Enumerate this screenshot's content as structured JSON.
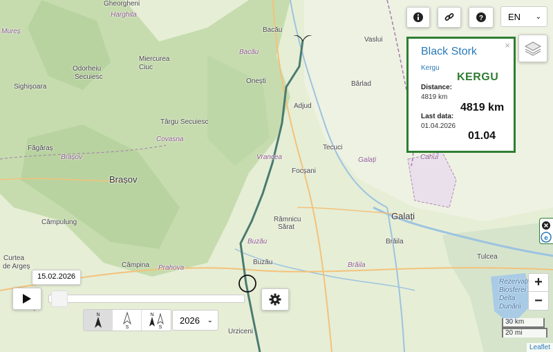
{
  "toolbar": {
    "info_icon": "info-icon",
    "link_icon": "link-icon",
    "help_icon": "help-icon",
    "language": "EN"
  },
  "card": {
    "title": "Black Stork",
    "close": "×",
    "subtitle": "Kergu",
    "name_badge": "KERGU",
    "distance_label": "Distance:",
    "distance_value": "4819 km",
    "distance_big": "4819 km",
    "lastdata_label": "Last data:",
    "lastdata_value": "01.04.2026",
    "lastdata_big": "01.04"
  },
  "timeline": {
    "date": "15.02.2026",
    "year": "2026",
    "compass": [
      "N",
      "S",
      "N",
      "S"
    ]
  },
  "zoom": {
    "in": "+",
    "out": "−"
  },
  "scale": {
    "km": "30 km",
    "mi": "20 mi"
  },
  "attribution": "Leaflet",
  "places": {
    "gheorgheni": "Gheorgheni",
    "harghita": "Harghita",
    "mures": "Mureș",
    "bacau_city": "Bacău",
    "bacau_region": "Bacău",
    "vaslui": "Vaslui",
    "miercurea": "Miercurea",
    "ciuc": "Ciuc",
    "odorheiu": "Odorheiu",
    "secuiesc": "Secuiesc",
    "sighisoara": "Sighișoara",
    "onesti": "Onești",
    "barlad": "Bârlad",
    "adjud": "Adjud",
    "targu": "Târgu Secuiesc",
    "covasna": "Covasna",
    "fagaras": "Făgăraș",
    "brasov_region": "Brașov",
    "brasov_city": "Brașov",
    "tecuci": "Tecuci",
    "galati_region": "Galați",
    "cahul": "Cahul",
    "vrancea": "Vrancea",
    "focsani": "Focșani",
    "ramnicu": "Râmnicu",
    "sarat": "Sărat",
    "galati_city": "Galați",
    "campulung": "Câmpulung",
    "buzau_region": "Buzău",
    "braila_city": "Brăila",
    "tulcea": "Tulcea",
    "curtea": "Curtea",
    "de_arges": "de Argeș",
    "buzau_city": "Buzău",
    "braila_region": "Brăila",
    "campina": "Câmpina",
    "prahova": "Prahova",
    "pitesti": "Pitești",
    "urziceni": "Urziceni",
    "delta1": "Rezervația",
    "delta2": "Biosferei",
    "delta3": "Delta",
    "delta4": "Dunării"
  },
  "colors": {
    "track": "#4a7a70",
    "card_border": "#2e7d32",
    "link_blue": "#2a7ab8"
  }
}
